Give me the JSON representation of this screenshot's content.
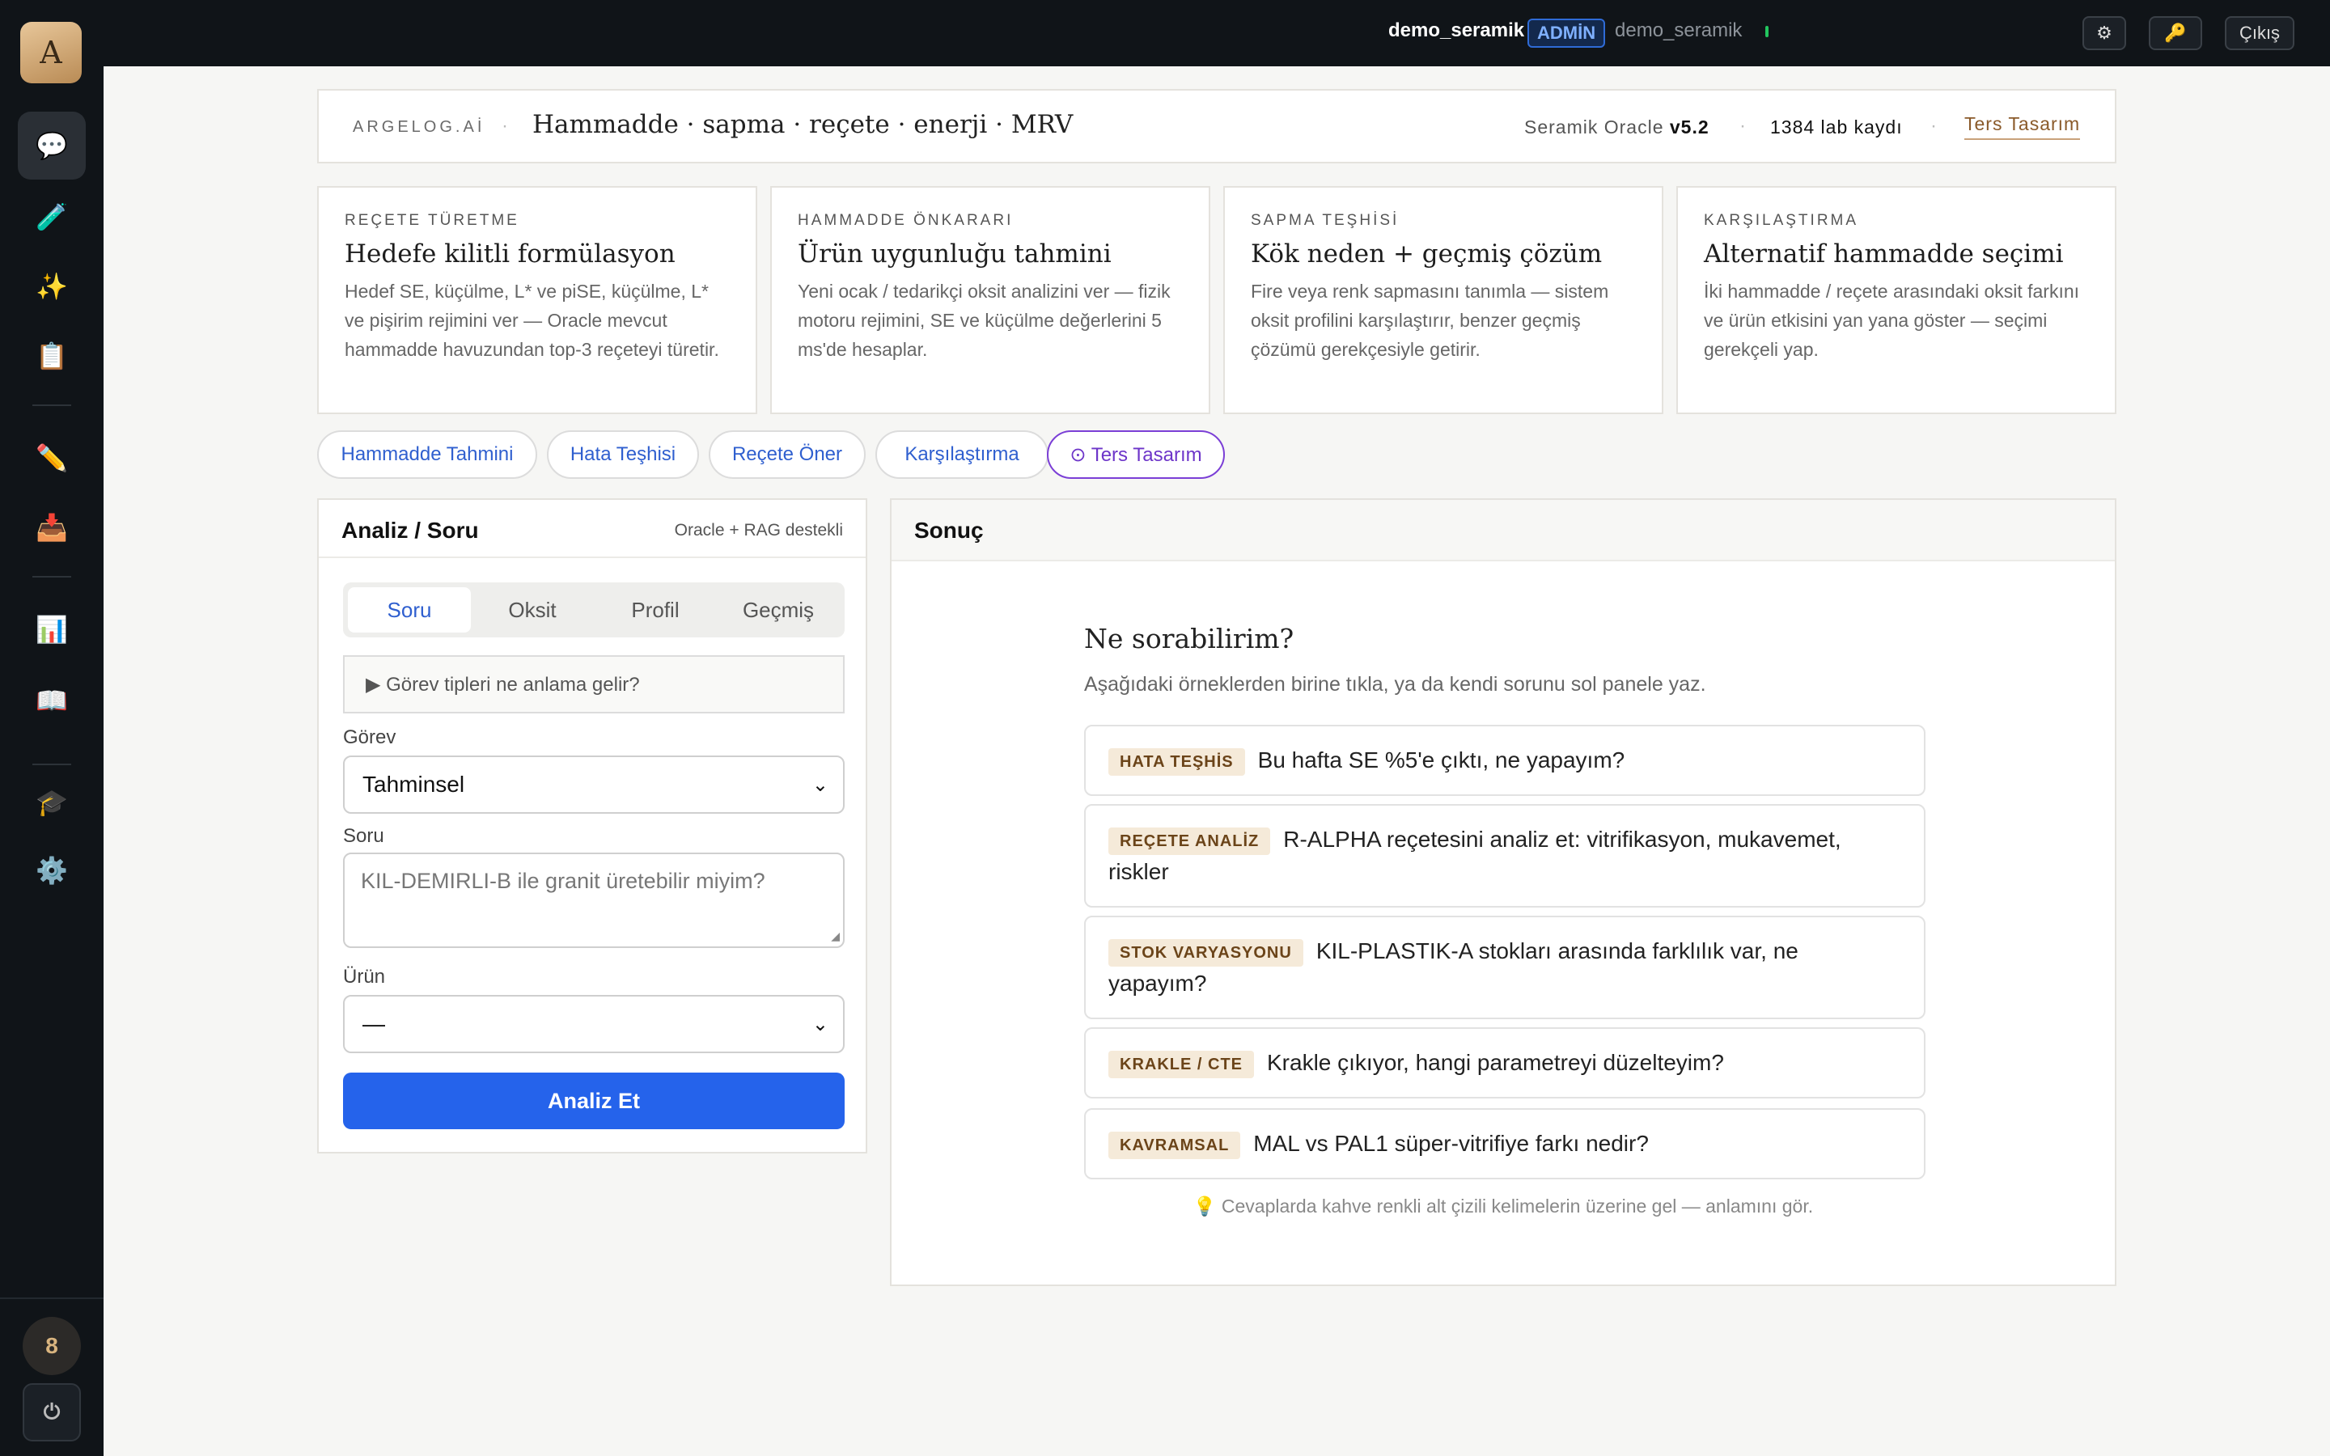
{
  "sidebar": {
    "logo": "A",
    "items": [
      {
        "icon": "chat-icon",
        "glyph": "💬",
        "active": true
      },
      {
        "icon": "pipette-icon",
        "glyph": "🧪",
        "active": false
      },
      {
        "icon": "sparkles-icon",
        "glyph": "✨",
        "active": false
      },
      {
        "icon": "clipboard-icon",
        "glyph": "📋",
        "active": false
      },
      {
        "icon": "pencil-icon",
        "glyph": "✏️",
        "active": false
      },
      {
        "icon": "inbox-icon",
        "glyph": "📥",
        "active": false
      },
      {
        "icon": "chart-icon",
        "glyph": "📊",
        "active": false
      },
      {
        "icon": "book-icon",
        "glyph": "📖",
        "active": false
      },
      {
        "icon": "graduation-cap-icon",
        "glyph": "🎓",
        "active": false
      },
      {
        "icon": "gear-icon",
        "glyph": "⚙️",
        "active": false
      }
    ],
    "badge_count": "8",
    "power_glyph": "⏻"
  },
  "topbar": {
    "user": "demo_seramik",
    "role": "ADMİN",
    "user_secondary": "demo_seramik",
    "settings_glyph": "⚙",
    "key_glyph": "🔑",
    "logout_label": "Çıkış"
  },
  "header": {
    "brand": "ARGELOG.Aİ",
    "sep": "·",
    "title": "Hammadde · sapma · reçete · enerji · MRV",
    "oracle_label": "Seramik Oracle",
    "oracle_version": "v5.2",
    "lab_count": "1384 lab kaydı",
    "ters_link": "Ters Tasarım"
  },
  "cards": [
    {
      "eyebrow": "REÇETE TÜRETME",
      "title": "Hedefe kilitli formülasyon",
      "desc": "Hedef SE, küçülme, L* ve piSE, küçülme, L* ve pişirim rejimini ver — Oracle mevcut hammadde havuzundan top-3 reçeteyi türetir."
    },
    {
      "eyebrow": "HAMMADDE ÖNKARARI",
      "title": "Ürün uygunluğu tahmini",
      "desc": "Yeni ocak / tedarikçi oksit analizini ver — fizik motoru rejimini, SE ve küçülme değerlerini 5 ms'de hesaplar."
    },
    {
      "eyebrow": "SAPMA TEŞHİSİ",
      "title": "Kök neden + geçmiş çözüm",
      "desc": "Fire veya renk sapmasını tanımla — sistem oksit profilini karşılaştırır, benzer geçmiş çözümü gerekçesiyle getirir."
    },
    {
      "eyebrow": "KARŞILAŞTIRMA",
      "title": "Alternatif hammadde seçimi",
      "desc": "İki hammadde / reçete arasındaki oksit farkını ve ürün etkisini yan yana göster — seçimi gerekçeli yap."
    }
  ],
  "pills": [
    {
      "label": "Hammadde Tahmini"
    },
    {
      "label": "Hata Teşhisi"
    },
    {
      "label": "Reçete Öner"
    },
    {
      "label": "Karşılaştırma"
    },
    {
      "label": "⊙ Ters Tasarım"
    }
  ],
  "left_panel": {
    "title": "Analiz / Soru",
    "subtitle": "Oracle + RAG destekli",
    "tabs": [
      "Soru",
      "Oksit",
      "Profil",
      "Geçmiş"
    ],
    "details_summary": "▶ Görev tipleri ne anlama gelir?",
    "gorev_label": "Görev",
    "gorev_value": "Tahminsel",
    "soru_label": "Soru",
    "soru_placeholder": "KIL-DEMIRLI-B ile granit üretebilir miyim?",
    "urun_label": "Ürün",
    "urun_value": "—",
    "submit": "Analiz Et"
  },
  "right_panel": {
    "title": "Sonuç",
    "ask_title": "Ne sorabilirim?",
    "ask_sub": "Aşağıdaki örneklerden birine tıkla, ya da kendi sorunu sol panele yaz.",
    "examples": [
      {
        "tag": "HATA TEŞHİS",
        "text": "Bu hafta SE %5'e çıktı, ne yapayım?"
      },
      {
        "tag": "REÇETE ANALİZ",
        "text": "R-ALPHA reçetesini analiz et: vitrifikasyon, mukavemet, riskler"
      },
      {
        "tag": "STOK VARYASYONU",
        "text": "KIL-PLASTIK-A stokları arasında farklılık var, ne yapayım?"
      },
      {
        "tag": "KRAKLE / CTE",
        "text": "Krakle çıkıyor, hangi parametreyi düzelteyim?"
      },
      {
        "tag": "KAVRAMSAL",
        "text": "MAL vs PAL1 süper-vitrifiye farkı nedir?"
      }
    ],
    "hint": "💡 Cevaplarda kahve renkli alt çizili kelimelerin üzerine gel — anlamını gör."
  }
}
